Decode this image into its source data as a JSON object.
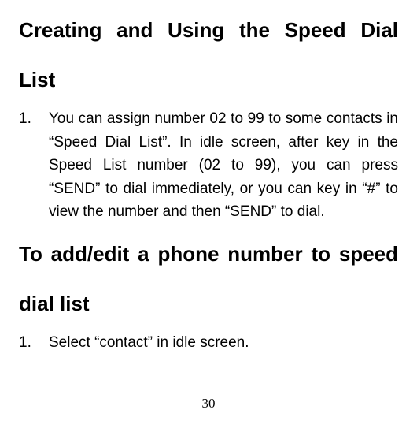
{
  "section1": {
    "heading_line1": "Creating and Using the Speed Dial",
    "heading_line2": "List",
    "item1_num": "1.",
    "item1_text": "You can assign number 02 to 99 to some contacts in “Speed Dial List”. In idle screen, after key in the Speed List number (02 to 99), you can press “SEND” to dial immediately, or you can key in “#” to view the number and then “SEND” to dial."
  },
  "section2": {
    "heading_line1": "To add/edit a phone number to speed",
    "heading_line2": "dial list",
    "item1_num": "1.",
    "item1_text": "Select “contact” in idle screen."
  },
  "page_number": "30"
}
